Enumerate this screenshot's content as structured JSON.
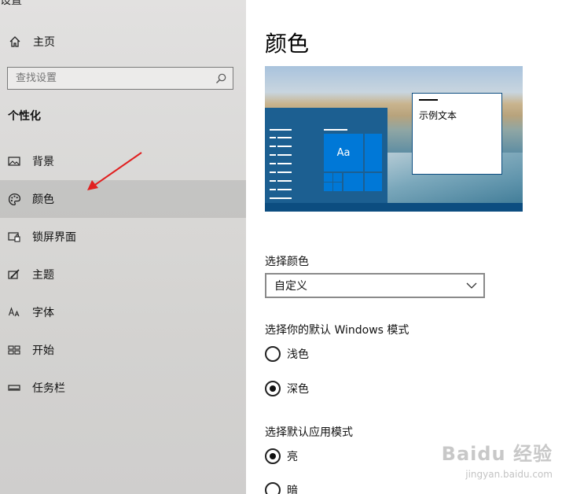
{
  "window": {
    "title_cut": "设置"
  },
  "sidebar": {
    "home_label": "主页",
    "search_placeholder": "查找设置",
    "section_title": "个性化",
    "items": [
      {
        "label": "背景",
        "icon": "picture-icon"
      },
      {
        "label": "颜色",
        "icon": "palette-icon",
        "active": true
      },
      {
        "label": "锁屏界面",
        "icon": "lock-screen-icon"
      },
      {
        "label": "主题",
        "icon": "theme-brush-icon"
      },
      {
        "label": "字体",
        "icon": "font-icon"
      },
      {
        "label": "开始",
        "icon": "start-grid-icon"
      },
      {
        "label": "任务栏",
        "icon": "taskbar-icon"
      }
    ]
  },
  "main": {
    "page_title": "颜色",
    "preview": {
      "tile_text": "Aa",
      "sample_text": "示例文本"
    },
    "choose_color_label": "选择颜色",
    "choose_color_value": "自定义",
    "windows_mode_label": "选择你的默认 Windows 模式",
    "windows_mode_options": [
      {
        "label": "浅色",
        "selected": false
      },
      {
        "label": "深色",
        "selected": true
      }
    ],
    "app_mode_label": "选择默认应用模式",
    "app_mode_options": [
      {
        "label": "亮",
        "selected": true
      },
      {
        "label": "暗",
        "selected": false
      }
    ]
  },
  "watermark": {
    "brand": "Baidu 经验",
    "url": "jingyan.baidu.com"
  },
  "colors": {
    "accent": "#0078d7",
    "annotation_arrow": "#e02020"
  }
}
